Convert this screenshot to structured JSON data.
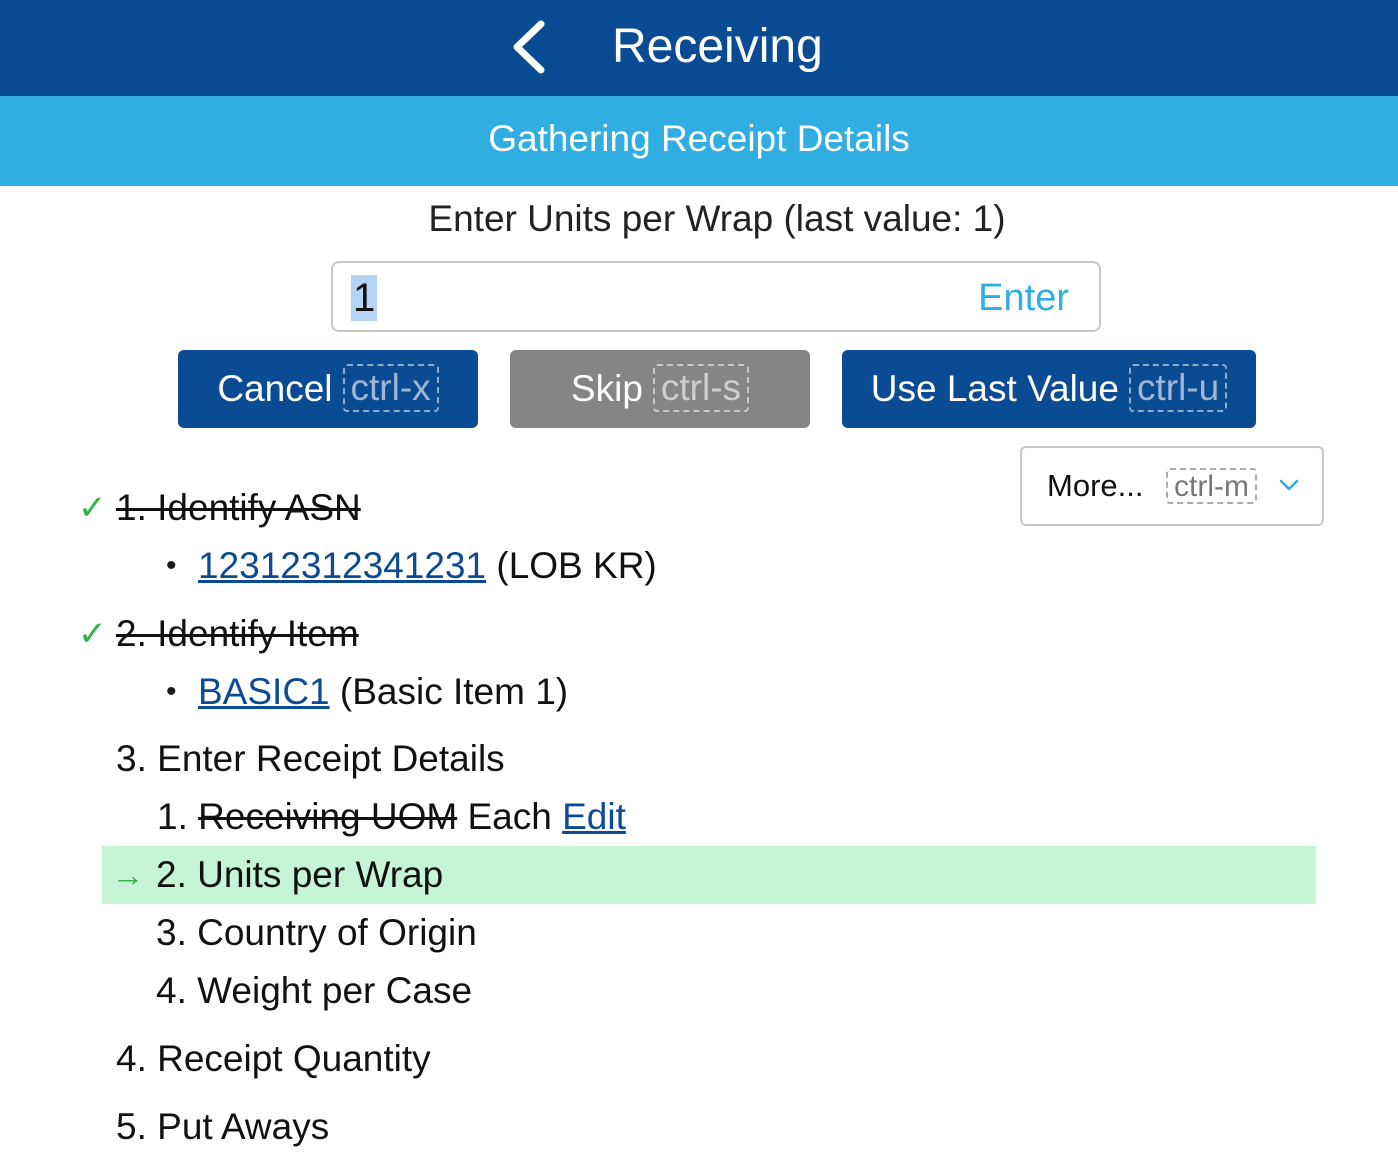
{
  "header": {
    "title": "Receiving",
    "subtitle": "Gathering Receipt Details"
  },
  "prompt": {
    "text": "Enter Units per Wrap (last value: 1)"
  },
  "input": {
    "value": "1",
    "enter_label": "Enter"
  },
  "buttons": {
    "cancel": {
      "label": "Cancel",
      "shortcut": "ctrl-x"
    },
    "skip": {
      "label": "Skip",
      "shortcut": "ctrl-s"
    },
    "use_last": {
      "label": "Use Last Value",
      "shortcut": "ctrl-u"
    },
    "more": {
      "label": "More...",
      "shortcut": "ctrl-m"
    }
  },
  "steps": {
    "s1": {
      "label": "1. Identify ASN",
      "check": "✓",
      "link": "12312312341231",
      "detail": "(LOB KR)"
    },
    "s2": {
      "label": "2. Identify Item",
      "check": "✓",
      "link": "BASIC1",
      "detail": "(Basic Item 1)"
    },
    "s3": {
      "label": "3. Enter Receipt Details",
      "sub1": {
        "num": "1.",
        "label": "Receiving UOM",
        "value": "Each",
        "edit": "Edit"
      },
      "sub2": {
        "arrow": "→",
        "label": "2. Units per Wrap"
      },
      "sub3": {
        "label": "3. Country of Origin"
      },
      "sub4": {
        "label": "4. Weight per Case"
      }
    },
    "s4": {
      "label": "4. Receipt Quantity"
    },
    "s5": {
      "label": "5. Put Aways"
    }
  },
  "colors": {
    "header_bg": "#0a4b93",
    "subheader_bg": "#30aee2",
    "check": "#2fb24a",
    "highlight": "#c6f4d6",
    "disabled_button": "#858585"
  }
}
